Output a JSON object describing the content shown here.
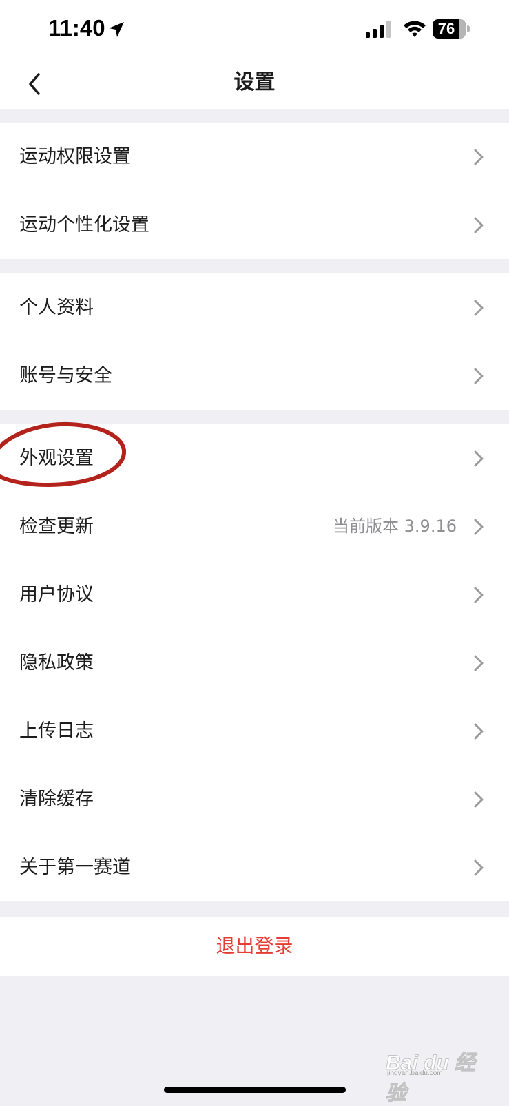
{
  "status_bar": {
    "time": "11:40",
    "battery": "76"
  },
  "header": {
    "title": "设置"
  },
  "groups": [
    {
      "items": [
        {
          "label": "运动权限设置"
        },
        {
          "label": "运动个性化设置"
        }
      ]
    },
    {
      "items": [
        {
          "label": "个人资料"
        },
        {
          "label": "账号与安全"
        }
      ]
    },
    {
      "items": [
        {
          "label": "外观设置"
        },
        {
          "label": "检查更新",
          "value": "当前版本 3.9.16"
        },
        {
          "label": "用户协议"
        },
        {
          "label": "隐私政策"
        },
        {
          "label": "上传日志"
        },
        {
          "label": "清除缓存"
        },
        {
          "label": "关于第一赛道"
        }
      ]
    }
  ],
  "logout": {
    "label": "退出登录"
  },
  "watermark": {
    "text": "Bai du 经验",
    "sub": "jingyan.baidu.com"
  },
  "colors": {
    "accent_red": "#e43d33",
    "annotation_red": "#b3231c",
    "background": "#f0f0f4"
  }
}
